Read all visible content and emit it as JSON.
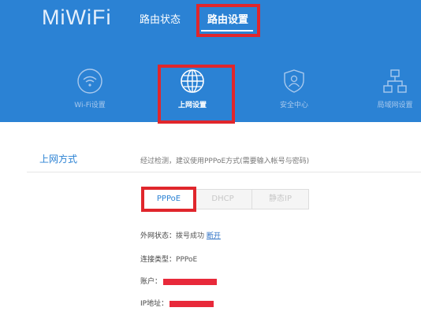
{
  "header": {
    "logo": "MiWiFi",
    "nav": [
      {
        "label": "路由状态",
        "active": false
      },
      {
        "label": "路由设置",
        "active": true
      }
    ],
    "tiles": [
      {
        "label": "Wi-Fi设置",
        "icon": "wifi-icon",
        "active": false
      },
      {
        "label": "上网设置",
        "icon": "globe-icon",
        "active": true
      },
      {
        "label": "安全中心",
        "icon": "shield-person-icon",
        "active": false
      },
      {
        "label": "局域网设置",
        "icon": "network-icon",
        "active": false
      }
    ]
  },
  "section": {
    "title": "上网方式",
    "hint": "经过检测，建议使用PPPoE方式(需要输入帐号与密码)"
  },
  "modes": [
    {
      "label": "PPPoE",
      "active": true
    },
    {
      "label": "DHCP",
      "active": false
    },
    {
      "label": "静态IP",
      "active": false
    }
  ],
  "info": {
    "wan_status_label": "外网状态：",
    "wan_status_value": "拨号成功",
    "disconnect_link": "断开",
    "conn_type_label": "连接类型：",
    "conn_type_value": "PPPoE",
    "account_label": "账户：",
    "ip_label": "IP地址："
  },
  "colors": {
    "header_blue": "#2b82d4",
    "highlight_red": "#e0262c",
    "redaction_red": "#e8293a"
  }
}
